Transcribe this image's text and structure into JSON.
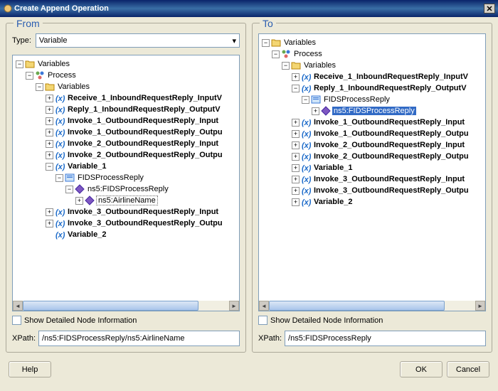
{
  "dialog": {
    "title": "Create Append Operation"
  },
  "from": {
    "title": "From",
    "type_label": "Type:",
    "type_value": "Variable",
    "root": "Variables",
    "process": "Process",
    "vars": "Variables",
    "tree": {
      "r1": "Receive_1_InboundRequestReply_InputV",
      "r2": "Reply_1_InboundRequestReply_OutputV",
      "r3": "Invoke_1_OutboundRequestReply_Input",
      "r4": "Invoke_1_OutboundRequestReply_Outpu",
      "r5": "Invoke_2_OutboundRequestReply_Input",
      "r6": "Invoke_2_OutboundRequestReply_Outpu",
      "v1": "Variable_1",
      "fpr": "FIDSProcessReply",
      "ns5fpr": "ns5:FIDSProcessReply",
      "airline": "ns5:AirlineName",
      "r7": "Invoke_3_OutboundRequestReply_Input",
      "r8": "Invoke_3_OutboundRequestReply_Outpu",
      "v2": "Variable_2"
    },
    "show_detailed": "Show Detailed Node Information",
    "xpath_label": "XPath:",
    "xpath_value": "/ns5:FIDSProcessReply/ns5:AirlineName"
  },
  "to": {
    "title": "To",
    "root": "Variables",
    "process": "Process",
    "vars": "Variables",
    "tree": {
      "r1": "Receive_1_InboundRequestReply_InputV",
      "r2": "Reply_1_InboundRequestReply_OutputV",
      "fpr": "FIDSProcessReply",
      "ns5fpr": "ns5:FIDSProcessReply",
      "r3": "Invoke_1_OutboundRequestReply_Input",
      "r4": "Invoke_1_OutboundRequestReply_Outpu",
      "r5": "Invoke_2_OutboundRequestReply_Input",
      "r6": "Invoke_2_OutboundRequestReply_Outpu",
      "v1": "Variable_1",
      "r7": "Invoke_3_OutboundRequestReply_Input",
      "r8": "Invoke_3_OutboundRequestReply_Outpu",
      "v2": "Variable_2"
    },
    "show_detailed": "Show Detailed Node Information",
    "xpath_label": "XPath:",
    "xpath_value": "/ns5:FIDSProcessReply"
  },
  "buttons": {
    "help": "Help",
    "ok": "OK",
    "cancel": "Cancel"
  }
}
